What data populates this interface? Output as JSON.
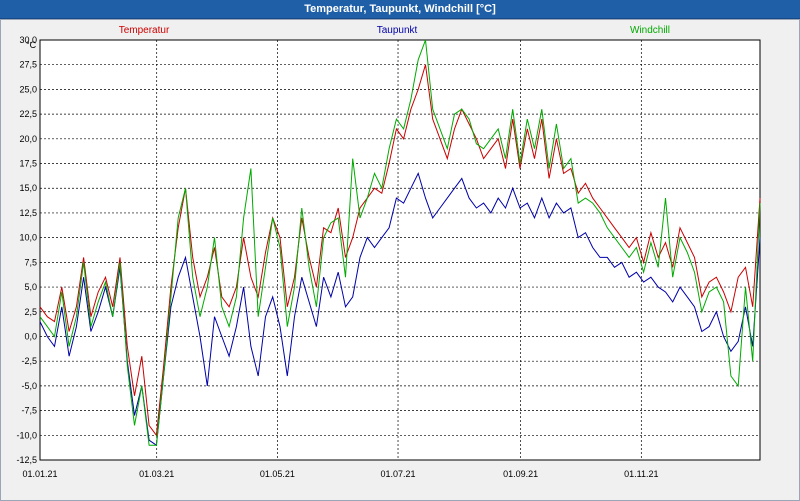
{
  "window": {
    "title": "Temperatur, Taupunkt, Windchill [°C]"
  },
  "chart_data": {
    "type": "line",
    "title": "Temperatur, Taupunkt, Windchill [°C]",
    "ylabel": "°C",
    "ylim": [
      -12.5,
      30.0
    ],
    "grid": true,
    "legend_position": "top",
    "y_ticks": [
      "30,0",
      "27,5",
      "25,0",
      "22,5",
      "20,0",
      "17,5",
      "15,0",
      "12,5",
      "10,0",
      "7,5",
      "5,0",
      "2,5",
      "0,0",
      "-2,5",
      "-5,0",
      "-7,5",
      "-10,0",
      "-12,5"
    ],
    "x_ticks": [
      "01.01.21",
      "01.03.21",
      "01.05.21",
      "01.07.21",
      "01.09.21",
      "01.11.21"
    ],
    "x_tick_days": [
      0,
      59,
      120,
      181,
      243,
      304
    ],
    "x_range_days": [
      0,
      364
    ],
    "series": [
      {
        "name": "Temperatur",
        "color": "#cc0000",
        "values": [
          3.0,
          2.0,
          1.5,
          5.0,
          0.5,
          3.0,
          8.0,
          2.0,
          4.5,
          6.0,
          3.0,
          8.0,
          -1.0,
          -6.0,
          -2.0,
          -9.0,
          -10.0,
          -3.0,
          5.0,
          11.0,
          15.0,
          8.0,
          4.0,
          6.0,
          9.0,
          4.0,
          3.0,
          5.0,
          10.0,
          6.0,
          4.0,
          8.5,
          12.0,
          10.0,
          3.0,
          6.0,
          12.0,
          8.0,
          5.0,
          11.0,
          10.5,
          13.0,
          8.0,
          10.0,
          13.0,
          14.0,
          15.0,
          14.5,
          17.5,
          21.0,
          20.0,
          23.0,
          25.0,
          27.5,
          22.0,
          20.0,
          18.0,
          21.0,
          23.0,
          21.5,
          20.0,
          18.0,
          19.0,
          20.0,
          17.0,
          22.0,
          17.0,
          21.0,
          18.0,
          22.0,
          16.0,
          20.0,
          16.5,
          17.0,
          14.5,
          15.5,
          14.0,
          13.0,
          12.0,
          11.0,
          10.0,
          9.0,
          10.0,
          7.5,
          10.5,
          8.0,
          9.5,
          7.0,
          11.0,
          9.5,
          8.0,
          4.0,
          5.5,
          6.0,
          4.5,
          2.5,
          6.0,
          7.0,
          3.0,
          14.0
        ]
      },
      {
        "name": "Taupunkt",
        "color": "#0000aa",
        "values": [
          1.5,
          0.0,
          -1.0,
          3.0,
          -2.0,
          1.0,
          6.0,
          0.5,
          2.5,
          5.0,
          2.0,
          7.0,
          -2.5,
          -8.0,
          -5.0,
          -10.5,
          -11.0,
          -4.0,
          3.0,
          6.0,
          8.0,
          4.0,
          0.0,
          -5.0,
          2.0,
          0.0,
          -2.0,
          1.0,
          5.0,
          -1.0,
          -4.0,
          2.0,
          4.0,
          1.0,
          -4.0,
          2.0,
          6.0,
          3.5,
          1.0,
          6.0,
          4.0,
          6.5,
          3.0,
          4.0,
          8.0,
          10.0,
          9.0,
          10.0,
          11.0,
          14.0,
          13.5,
          15.0,
          16.5,
          14.0,
          12.0,
          13.0,
          14.0,
          15.0,
          16.0,
          14.0,
          13.0,
          13.5,
          12.5,
          14.0,
          13.0,
          15.0,
          13.0,
          13.5,
          12.0,
          14.0,
          12.0,
          13.5,
          12.5,
          13.0,
          10.0,
          10.5,
          9.0,
          8.0,
          8.0,
          7.0,
          7.5,
          6.0,
          6.5,
          5.5,
          6.0,
          5.0,
          4.5,
          3.5,
          5.0,
          4.0,
          3.0,
          0.5,
          1.0,
          2.5,
          0.0,
          -1.5,
          -0.5,
          3.0,
          -1.0,
          10.0
        ]
      },
      {
        "name": "Windchill",
        "color": "#00aa00",
        "values": [
          2.0,
          1.0,
          0.0,
          4.5,
          -1.0,
          2.0,
          7.5,
          1.0,
          3.5,
          5.5,
          2.0,
          7.5,
          -3.0,
          -9.0,
          -5.0,
          -11.0,
          -11.0,
          -4.0,
          4.0,
          12.0,
          15.0,
          6.0,
          2.0,
          5.0,
          10.0,
          3.0,
          1.0,
          4.0,
          12.0,
          17.0,
          2.0,
          7.0,
          12.0,
          9.0,
          1.0,
          5.0,
          13.0,
          7.0,
          3.0,
          10.0,
          11.5,
          12.0,
          6.0,
          18.0,
          12.0,
          14.0,
          16.5,
          15.0,
          19.0,
          22.0,
          21.0,
          24.0,
          28.0,
          30.0,
          23.0,
          21.0,
          19.0,
          22.5,
          23.0,
          22.0,
          19.5,
          19.0,
          20.0,
          21.0,
          18.0,
          23.0,
          17.5,
          22.0,
          19.0,
          23.0,
          17.0,
          21.5,
          17.0,
          18.0,
          13.5,
          14.0,
          13.5,
          12.5,
          11.0,
          10.0,
          9.0,
          8.0,
          9.0,
          6.5,
          9.5,
          7.0,
          14.0,
          6.0,
          10.0,
          8.5,
          6.5,
          2.5,
          4.5,
          5.0,
          3.5,
          -4.0,
          -5.0,
          5.0,
          -2.5,
          13.5
        ]
      }
    ]
  }
}
